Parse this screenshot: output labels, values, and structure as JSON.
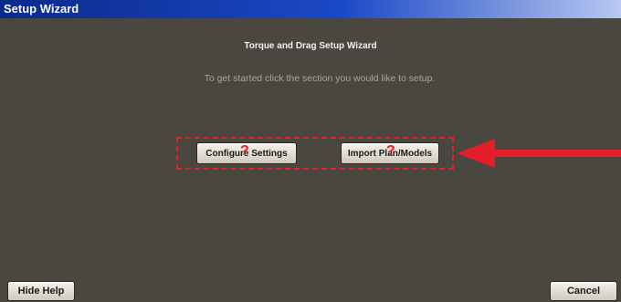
{
  "window": {
    "title": "Setup Wizard"
  },
  "main": {
    "heading": "Torque and Drag Setup Wizard",
    "subheading": "To get started click the section you would like to setup."
  },
  "buttons": {
    "configure_settings": "Configure Settings",
    "import_plan_models": "Import Plan/Models",
    "hide_help": "Hide Help",
    "cancel": "Cancel"
  },
  "annotations": {
    "help_marker": "?",
    "highlight_color": "#e0222a",
    "arrow_color": "#e3202a"
  }
}
